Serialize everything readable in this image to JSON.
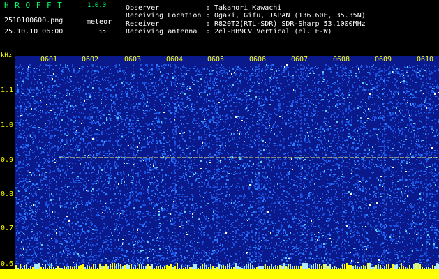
{
  "app": {
    "name": "H R O F F T",
    "version": "1.0.0"
  },
  "info": {
    "filename": "2510100600.png",
    "datetime": "25.10.10 06:00",
    "mode_label": "meteor",
    "count": "35"
  },
  "fields": [
    {
      "label": "Observer",
      "value": "Takanori Kawachi"
    },
    {
      "label": "Receiving Location",
      "value": "Ogaki, Gifu, JAPAN (136.60E, 35.35N)"
    },
    {
      "label": "Receiver",
      "value": "R820T2(RTL-SDR) SDR-Sharp 53.1000MHz"
    },
    {
      "label": "Receiving antenna",
      "value": "2el-HB9CV Vertical (el. E-W)"
    }
  ],
  "separator": ":",
  "yaxis": {
    "unit": "kHz",
    "ticks": [
      "1.1",
      "1.0",
      "0.9",
      "0.8",
      "0.7",
      "0.6"
    ],
    "range": [
      0.57,
      1.2
    ]
  },
  "xaxis": {
    "ticks": [
      "0601",
      "0602",
      "0603",
      "0604",
      "0605",
      "0606",
      "0607",
      "0608",
      "0609",
      "0610"
    ]
  },
  "colors": {
    "background": "#000000",
    "spectrum_dark": "#0a1a8c",
    "spectrum_mid": "#1e6aff",
    "spectrum_hot": "#ffffff",
    "signal": "#ffff66",
    "header_green": "#00ff66",
    "axis_yellow": "#ffff00"
  }
}
